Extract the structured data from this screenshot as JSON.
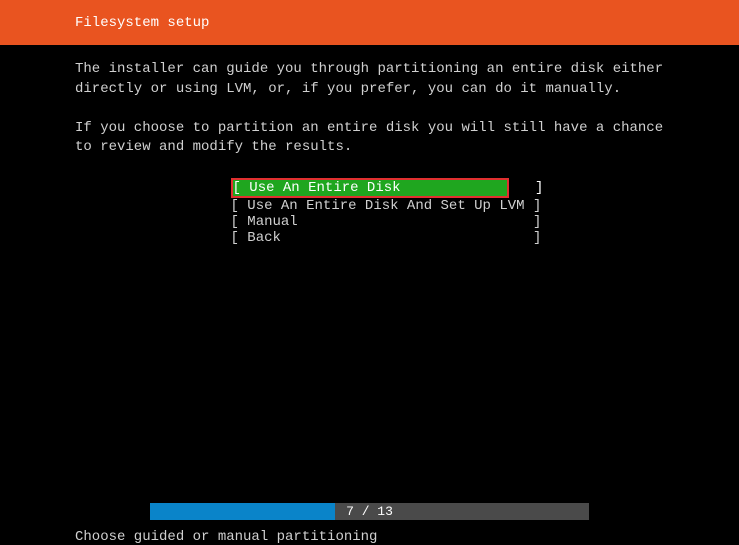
{
  "header": {
    "title": "Filesystem setup"
  },
  "description": {
    "para1": "The installer can guide you through partitioning an entire disk either directly or using LVM, or, if you prefer, you can do it manually.",
    "para2": "If you choose to partition an entire disk you will still have a chance to review and modify the results."
  },
  "menu": {
    "items": [
      {
        "text": "[ Use An Entire Disk                ]",
        "selected": true
      },
      {
        "text": "[ Use An Entire Disk And Set Up LVM ]",
        "selected": false
      },
      {
        "text": "[ Manual                            ]",
        "selected": false
      },
      {
        "text": "[ Back                              ]",
        "selected": false
      }
    ]
  },
  "progress": {
    "text": "7 / 13"
  },
  "footer": {
    "hint": "Choose guided or manual partitioning"
  }
}
